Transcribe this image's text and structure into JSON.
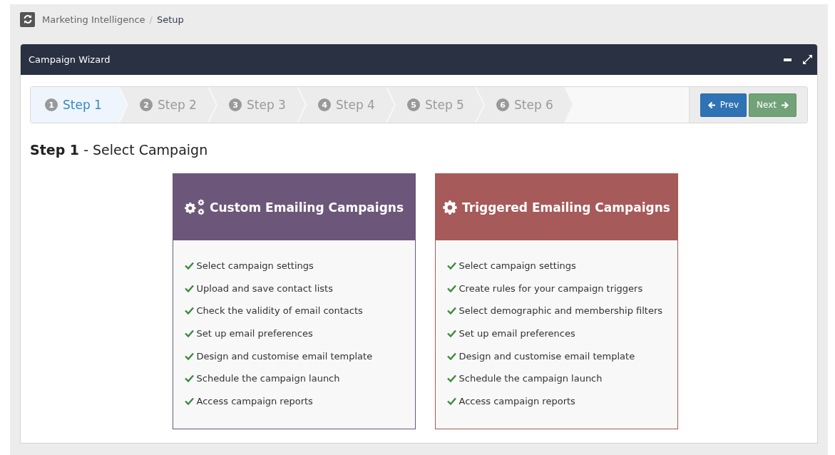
{
  "breadcrumb": [
    {
      "label": "Marketing Intelligence",
      "current": false
    },
    {
      "label": "Setup",
      "current": true
    }
  ],
  "breadcrumb_separator": "/",
  "panel": {
    "title": "Campaign Wizard"
  },
  "steps": [
    {
      "number": "1",
      "label": "Step 1",
      "selected": true
    },
    {
      "number": "2",
      "label": "Step 2",
      "selected": false
    },
    {
      "number": "3",
      "label": "Step 3",
      "selected": false
    },
    {
      "number": "4",
      "label": "Step 4",
      "selected": false
    },
    {
      "number": "5",
      "label": "Step 5",
      "selected": false
    },
    {
      "number": "6",
      "label": "Step 6",
      "selected": false
    }
  ],
  "buttons": [
    {
      "kind": "prev",
      "label": "Prev"
    },
    {
      "kind": "next",
      "label": "Next"
    }
  ],
  "heading": "**Step 1** - Select Campaign",
  "cards": [
    {
      "kind": "gears",
      "title": "Custom Emailing Campaigns",
      "color": "#6c5679",
      "items": [
        "Select campaign settings",
        "Upload and save contact lists",
        "Check the validity of email contacts",
        "Set up email preferences",
        "Design and customise email template",
        "Schedule the campaign launch",
        "Access campaign reports"
      ]
    },
    {
      "kind": "gear",
      "title": "Triggered Emailing Campaigns",
      "color": "#a65a59",
      "items": [
        "Select campaign settings",
        "Create rules for your campaign triggers",
        "Select demographic and membership filters",
        "Set up email preferences",
        "Design and customise email template",
        "Schedule the campaign launch",
        "Access campaign reports"
      ]
    }
  ]
}
